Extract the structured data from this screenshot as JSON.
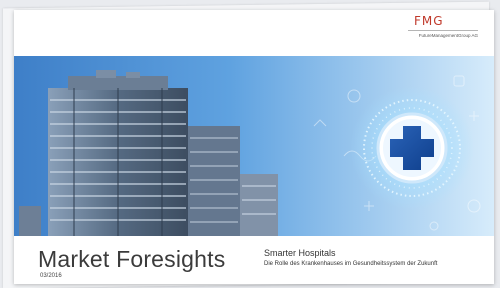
{
  "brand": {
    "logo_text": "FMG",
    "logo_subtext": "FutureManagementGroup AG",
    "accent": "#c0392b"
  },
  "cover": {
    "title": "Market Foresights",
    "date": "03/2016",
    "subtitle": "Smarter Hospitals",
    "description": "Die Rolle des Krankenhauses im Gesundheitssystem der Zukunft"
  },
  "hero": {
    "icon": "medical-cross-icon",
    "colors": {
      "sky": "#4f8fd4",
      "glow": "#d8f1ff",
      "building": "#5b6f87"
    }
  }
}
